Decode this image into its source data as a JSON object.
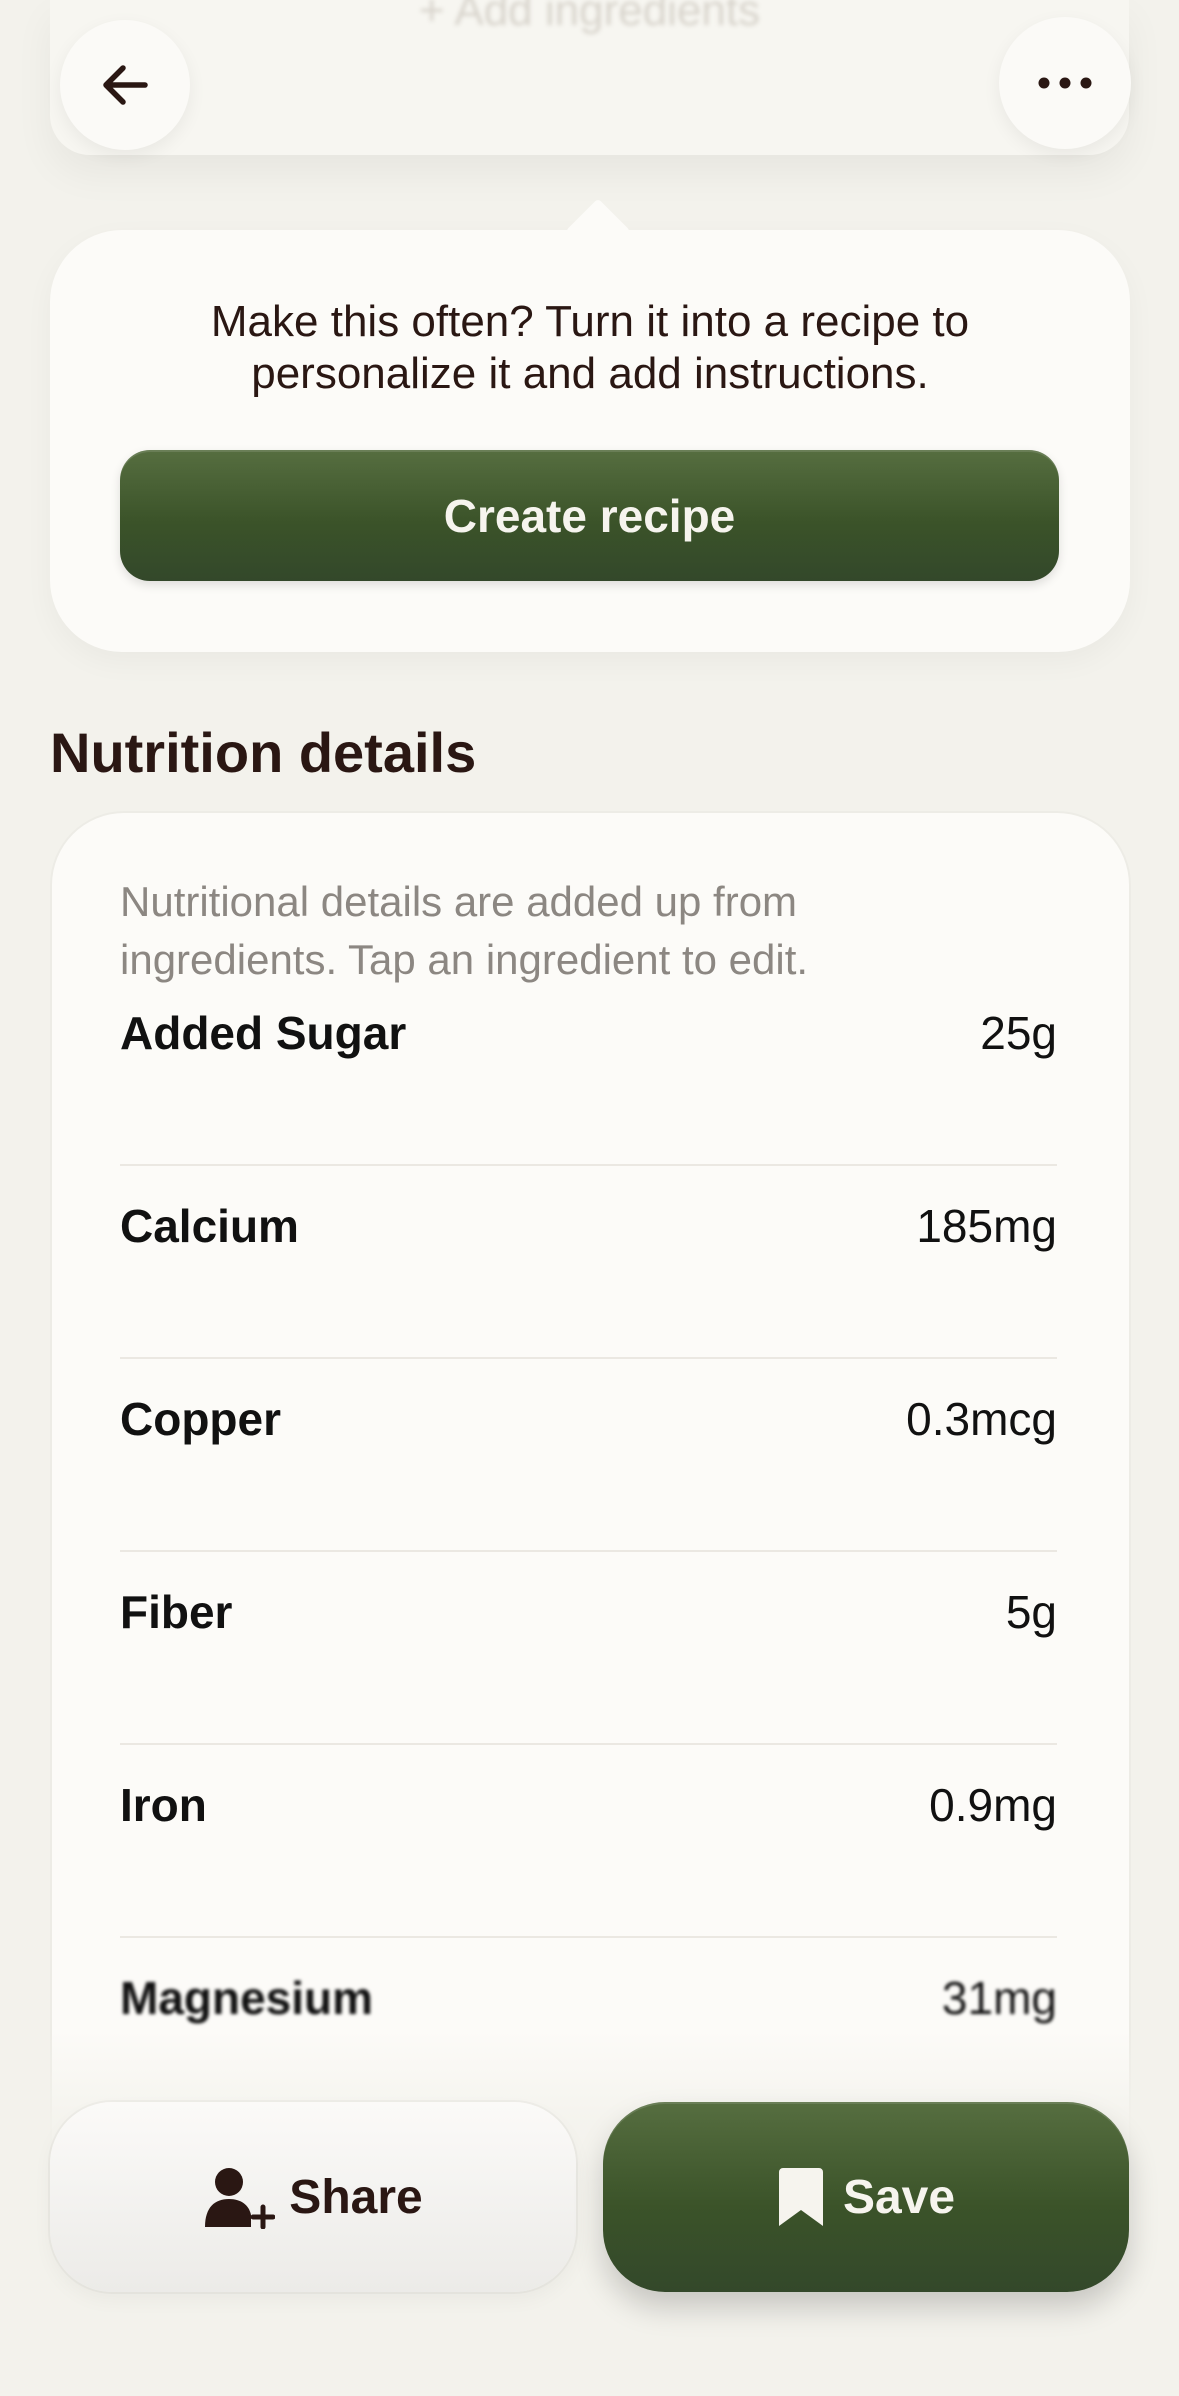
{
  "header": {
    "faded_label": "+ Add ingredients",
    "back_icon": "arrow-left-icon",
    "more_icon": "more-horizontal-icon"
  },
  "prompt": {
    "text": "Make this often? Turn it into a recipe to personalize it and add instructions.",
    "button_label": "Create recipe"
  },
  "nutrition": {
    "title": "Nutrition details",
    "note": "Nutritional details are added up from ingredients. Tap an ingredient to edit.",
    "rows": [
      {
        "name": "Added Sugar",
        "value": "25g"
      },
      {
        "name": "Calcium",
        "value": "185mg"
      },
      {
        "name": "Copper",
        "value": "0.3mcg"
      },
      {
        "name": "Fiber",
        "value": "5g"
      },
      {
        "name": "Iron",
        "value": "0.9mg"
      },
      {
        "name": "Magnesium",
        "value": "31mg"
      }
    ]
  },
  "actions": {
    "share_label": "Share",
    "save_label": "Save",
    "share_icon": "add-person-icon",
    "save_icon": "bookmark-icon"
  },
  "colors": {
    "accent_green": "#3b5329",
    "text_dark": "#2a1713",
    "background": "#f3f2ec"
  }
}
